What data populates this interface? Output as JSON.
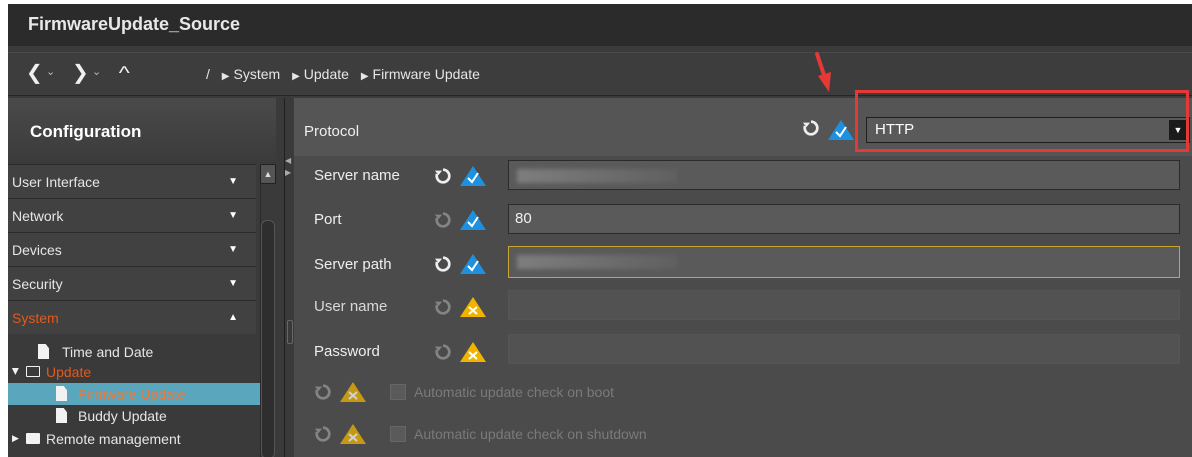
{
  "window": {
    "title": "FirmwareUpdate_Source"
  },
  "nav": {
    "back_icon": "chevron-left-icon",
    "forward_icon": "chevron-right-icon",
    "up_icon": "chevron-up-icon",
    "root": "/",
    "breadcrumbs": [
      "System",
      "Update",
      "Firmware Update"
    ]
  },
  "sidebar": {
    "title": "Configuration",
    "menu": [
      {
        "label": "User Interface",
        "expanded": false
      },
      {
        "label": "Network",
        "expanded": false
      },
      {
        "label": "Devices",
        "expanded": false
      },
      {
        "label": "Security",
        "expanded": false
      },
      {
        "label": "System",
        "expanded": true
      }
    ],
    "tree": [
      {
        "label": "Time and Date",
        "type": "page"
      },
      {
        "label": "Update",
        "type": "folder-open"
      },
      {
        "label": "Firmware Update",
        "type": "page",
        "selected": true
      },
      {
        "label": "Buddy Update",
        "type": "page"
      },
      {
        "label": "Remote management",
        "type": "folder"
      }
    ]
  },
  "form": {
    "protocol": {
      "label": "Protocol",
      "value": "HTTP",
      "status": "valid"
    },
    "server_name": {
      "label": "Server name",
      "value": "",
      "status": "valid"
    },
    "port": {
      "label": "Port",
      "value": "80",
      "status": "valid"
    },
    "server_path": {
      "label": "Server path",
      "value": "",
      "status": "valid"
    },
    "user_name": {
      "label": "User name",
      "value": "",
      "status": "warning"
    },
    "password": {
      "label": "Password",
      "value": "",
      "status": "warning"
    },
    "check_boot": {
      "label": "Automatic update check on boot",
      "checked": false,
      "status": "warning"
    },
    "check_shutdown": {
      "label": "Automatic update check on shutdown",
      "checked": false,
      "status": "warning"
    }
  },
  "colors": {
    "valid_icon": "#1e90e0",
    "warning_icon": "#f0b400",
    "highlight": "#e53935",
    "active_text": "#e05a1e",
    "selected_row": "#5aa6bd"
  }
}
